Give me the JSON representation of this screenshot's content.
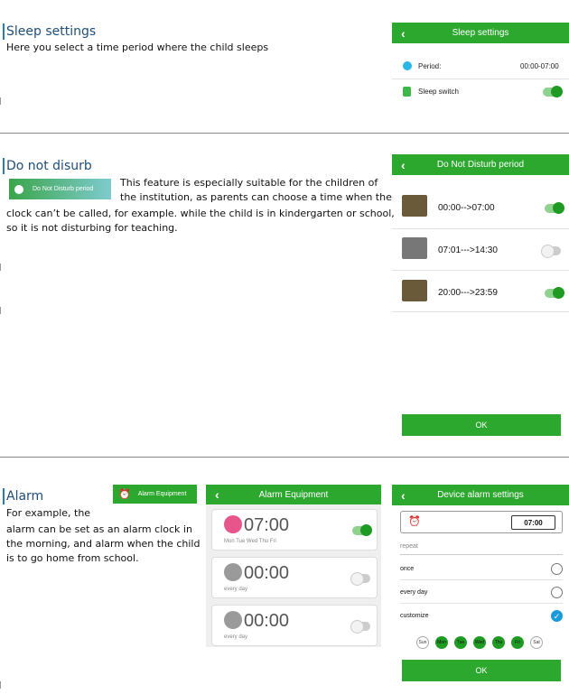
{
  "sleep": {
    "title": "Sleep settings",
    "description": "Here you select a time period where the child sleeps",
    "phone": {
      "header": "Sleep settings",
      "period_label": "Period:",
      "period_value": "00:00-07:00",
      "switch_label": "Sleep switch",
      "switch_on": true
    }
  },
  "dnd": {
    "title": "Do not disurb",
    "badge_label": "Do Not Disturb period",
    "description_lines": [
      "This feature is especially suitable for the children of",
      "the institution, as parents can choose a time when the",
      "clock can’t be called, for example. while the child is in kindergarten or school,",
      "so it is not disturbing for teaching."
    ],
    "phone": {
      "header": "Do Not Disturb period",
      "rows": [
        {
          "range": "00:00-->07:00",
          "on": true
        },
        {
          "range": "07:01--->14:30",
          "on": false
        },
        {
          "range": "20:00--->23:59",
          "on": true
        }
      ],
      "ok_label": "OK"
    }
  },
  "alarm": {
    "title": "Alarm",
    "badge_label": "Alarm Equipment",
    "description_lines": [
      "For example, the",
      "alarm can be set as an alarm clock in",
      "the morning, and alarm when the child",
      "is to go home from school."
    ],
    "equipment": {
      "header": "Alarm Equipment",
      "alarms": [
        {
          "time": "07:00",
          "repeat": "Mon Tue Wed Thu Fri",
          "on": true
        },
        {
          "time": "00:00",
          "repeat": "every day",
          "on": false
        },
        {
          "time": "00:00",
          "repeat": "every day",
          "on": false
        }
      ]
    },
    "settings": {
      "header": "Device alarm settings",
      "time_value": "07:00",
      "repeat_label": "repeat",
      "options": [
        {
          "label": "once",
          "checked": false
        },
        {
          "label": "every day",
          "checked": false
        },
        {
          "label": "customize",
          "checked": true
        }
      ],
      "days": [
        {
          "label": "Sun",
          "selected": false
        },
        {
          "label": "Mon",
          "selected": true
        },
        {
          "label": "Tue",
          "selected": true
        },
        {
          "label": "Wed",
          "selected": true
        },
        {
          "label": "Thu",
          "selected": true
        },
        {
          "label": "Fri",
          "selected": true
        },
        {
          "label": "Sat",
          "selected": false
        }
      ],
      "ok_label": "OK"
    }
  },
  "colors": {
    "brand_green": "#2da82f",
    "heading_blue": "#1f4e79"
  }
}
